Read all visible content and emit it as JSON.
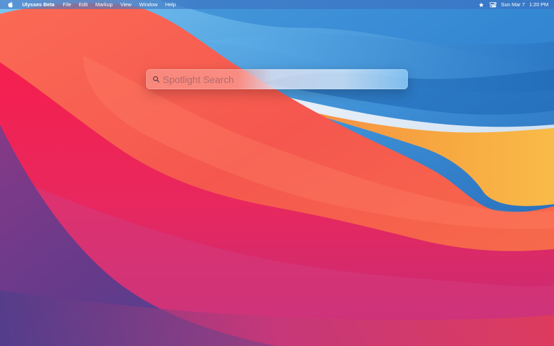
{
  "menubar": {
    "app_name": "Ulysses Beta",
    "menus": [
      "File",
      "Edit",
      "Markup",
      "View",
      "Window",
      "Help"
    ],
    "clock": {
      "date": "Sun Mar 7",
      "time": "1:20 PM"
    },
    "icons": {
      "apple": "apple-logo-icon",
      "status_star": "star-icon",
      "control_center": "control-center-icon"
    }
  },
  "spotlight": {
    "placeholder": "Spotlight Search",
    "value": "",
    "icon": "search-icon"
  },
  "colors": {
    "menubar_text": "#ffffff",
    "wallpaper_blue": "#2f7ccf",
    "wallpaper_red": "#f23a52",
    "wallpaper_orange": "#f6a940",
    "wallpaper_purple": "#5a3a8a"
  }
}
